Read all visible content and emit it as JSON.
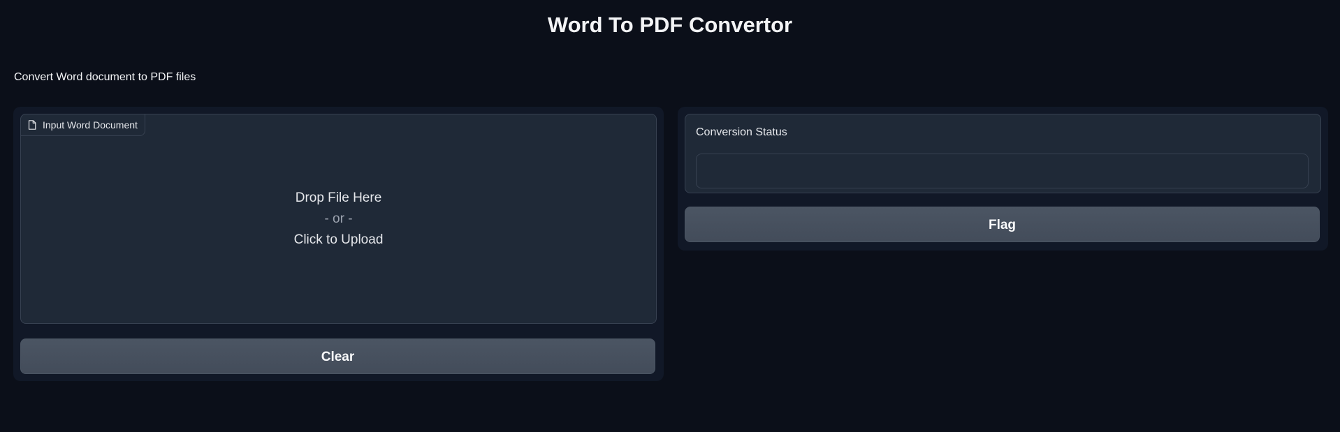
{
  "header": {
    "title": "Word To PDF Convertor",
    "description": "Convert Word document to PDF files"
  },
  "input_panel": {
    "upload": {
      "label": "Input Word Document",
      "icon": "file-icon",
      "drop_text": "Drop File Here",
      "or_text": "- or -",
      "click_text": "Click to Upload"
    },
    "clear_label": "Clear"
  },
  "output_panel": {
    "status_label": "Conversion Status",
    "status_value": "",
    "flag_label": "Flag"
  },
  "colors": {
    "background": "#0b0f19",
    "panel": "#111827",
    "block": "#1f2937",
    "border": "#374151",
    "button": "#4b5563"
  }
}
